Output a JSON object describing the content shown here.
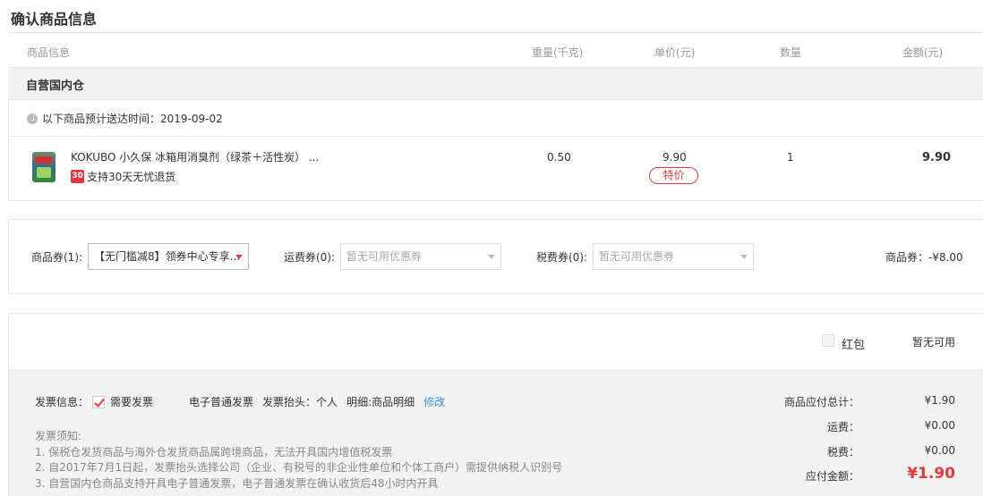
{
  "page": {
    "title": "确认商品信息"
  },
  "columns": {
    "info": "商品信息",
    "weight": "重量(千克)",
    "unit_price": "单价(元)",
    "qty": "数量",
    "amount": "金额(元)"
  },
  "warehouse": {
    "title": "自营国内仓",
    "delivery": "以下商品预计送达时间：2019-09-02"
  },
  "product": {
    "name": "KOKUBO 小久保 冰箱用消臭剂（绿茶＋活性炭） ...",
    "return_badge": "30",
    "return_text": "支持30天无忧退货",
    "weight": "0.50",
    "unit_price": "9.90",
    "price_tag": "特价",
    "qty": "1",
    "amount": "9.90"
  },
  "coupons": {
    "goods_label": "商品券(1):",
    "goods_selected": "【无门槛减8】领券中心专享...",
    "shipping_label": "运费券(0):",
    "shipping_placeholder": "暂无可用优惠券",
    "tax_label": "税费券(0):",
    "tax_placeholder": "暂无可用优惠券",
    "discount_text": "商品券：-¥8.00"
  },
  "red_packet": {
    "label": "红包",
    "status": "暂无可用"
  },
  "invoice": {
    "label": "发票信息：",
    "need": "需要发票",
    "type": "电子普通发票",
    "header": "发票抬头：个人",
    "detail": "明细:商品明细",
    "modify": "修改"
  },
  "notes": [
    "发票须知:",
    "1. 保税仓发货商品与海外仓发货商品属跨境商品，无法开具国内增值税发票",
    "2. 自2017年7月1日起，发票抬头选择公司（企业、有税号的非企业性单位和个体工商户）需提供纳税人识别号",
    "3. 自营国内仓商品支持开具电子普通发票，电子普通发票在确认收货后48小时内开具"
  ],
  "summary": {
    "goods_total_label": "商品应付总计：",
    "goods_total": "¥1.90",
    "shipping_label": "运费：",
    "shipping": "¥0.00",
    "tax_label": "税费：",
    "tax": "¥0.00",
    "payable_label": "应付金额：",
    "payable": "¥1.90"
  },
  "colors": {
    "accent": "#e4393c",
    "link": "#3a8ee6",
    "panel": "#f3f3f3"
  },
  "icons": [
    "clock-icon",
    "caret-down-icon",
    "checkbox-checked-icon"
  ]
}
